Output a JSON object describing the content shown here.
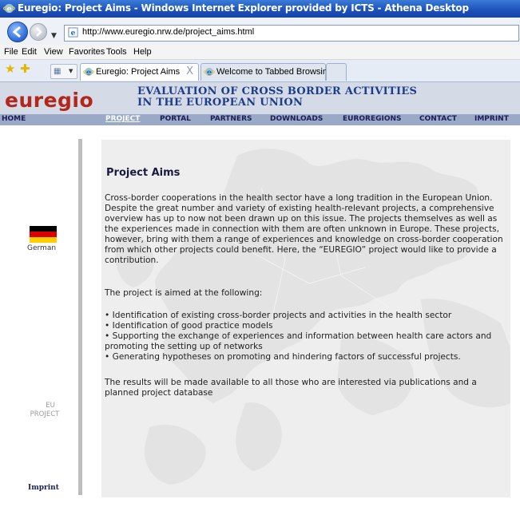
{
  "window": {
    "title": "Euregio: Project Aims - Windows Internet Explorer provided by ICTS - Athena Desktop"
  },
  "address": {
    "url": "http://www.euregio.nrw.de/project_aims.html"
  },
  "menu": {
    "items": [
      "File",
      "Edit",
      "View",
      "Favorites",
      "Tools",
      "Help"
    ]
  },
  "tabs": [
    {
      "label": "Euregio: Project Aims",
      "close": "X"
    },
    {
      "label": "Welcome to Tabbed Browsing"
    }
  ],
  "site": {
    "logo": "euregio",
    "title_line1": "EVALUATION OF CROSS BORDER ACTIVITIES",
    "title_line2": "IN THE EUROPEAN UNION",
    "nav": [
      "HOME",
      "PROJECT",
      "PORTAL",
      "PARTNERS",
      "DOWNLOADS",
      "EUROREGIONS",
      "CONTACT",
      "IMPRINT"
    ],
    "active_nav": "PROJECT"
  },
  "sidebar": {
    "language_label": "German",
    "eu_line1": "EU",
    "eu_line2": "PROJECT",
    "imprint": "Imprint"
  },
  "content": {
    "title": "Project Aims",
    "paragraph1": "Cross-border cooperations in the health sector have a long tradition in the European Union. Despite the great number and variety of existing health-relevant projects, a comprehensive overview has up to now not been drawn up on this issue. The projects themselves as well as the experiences made in connection with them are often unknown in Europe. These projects, however, bring with them a range of experiences and knowledge on cross-border cooperation from which other projects could benefit. Here, the “EUREGIO” project would like to provide a contribution.",
    "paragraph2": "The project is aimed at the following:",
    "bullets": [
      "• Identification of existing cross-border projects and activities in the health sector",
      "• Identification of good practice models",
      "• Supporting the exchange of experiences and information between health care actors and promoting the setting up of networks",
      "• Generating hypotheses on promoting and hindering factors of successful projects."
    ],
    "paragraph3": "The results will be made available to all those who are interested via publications and a planned project database"
  },
  "colors": {
    "logo": "#b5261a",
    "title": "#1d3d8a",
    "navbar": "#9aa9c8",
    "header": "#d5dbe6"
  }
}
